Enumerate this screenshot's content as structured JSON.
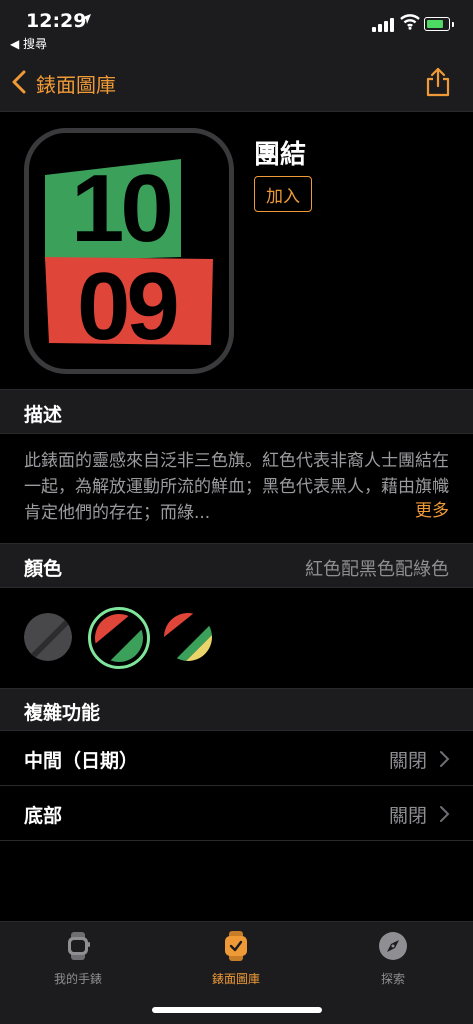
{
  "status_bar": {
    "time": "12:29",
    "back_to_app": "◀ 搜尋"
  },
  "nav": {
    "title": "錶面圖庫",
    "accent_color": "#f09a37"
  },
  "face": {
    "name": "團結",
    "hour": "10",
    "minute": "09",
    "add_label": "加入"
  },
  "description": {
    "header": "描述",
    "text": "此錶面的靈感來自泛非三色旗。紅色代表非裔人士團結在一起，為解放運動所流的鮮血；黑色代表黑人，藉由旗幟肯定他們的存在；而綠...",
    "more_label": "更多"
  },
  "color": {
    "header": "顏色",
    "selected_value": "紅色配黑色配綠色",
    "swatches": [
      "dark-gray",
      "red-black-green",
      "red-black-green-yellow"
    ],
    "selected_index": 1
  },
  "complications": {
    "header": "複雜功能",
    "rows": [
      {
        "label": "中間（日期）",
        "value": "關閉"
      },
      {
        "label": "底部",
        "value": "關閉"
      }
    ]
  },
  "tabbar": {
    "tabs": [
      {
        "label": "我的手錶",
        "icon": "watch-icon"
      },
      {
        "label": "錶面圖庫",
        "icon": "watch-face-icon"
      },
      {
        "label": "探索",
        "icon": "compass-icon"
      }
    ],
    "active_index": 1
  }
}
